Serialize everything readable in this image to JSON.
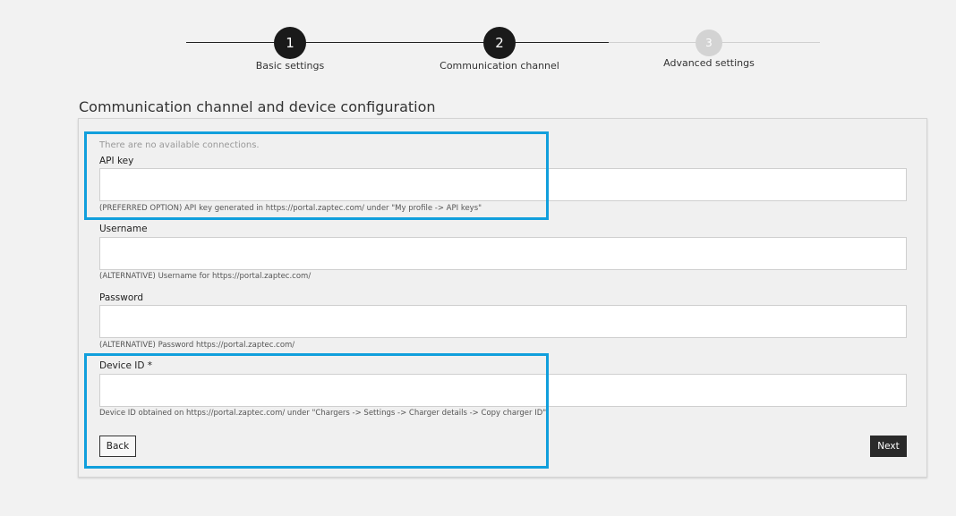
{
  "stepper": {
    "steps": [
      {
        "number": "1",
        "label": "Basic settings",
        "state": "completed"
      },
      {
        "number": "2",
        "label": "Communication channel",
        "state": "active"
      },
      {
        "number": "3",
        "label": "Advanced settings",
        "state": "pending"
      }
    ]
  },
  "section": {
    "title": "Communication channel and device configuration"
  },
  "form": {
    "note": "There are no available connections.",
    "api_key": {
      "label": "API key",
      "value": "",
      "hint": "(PREFERRED OPTION) API key generated in https://portal.zaptec.com/ under \"My profile -> API keys\""
    },
    "username": {
      "label": "Username",
      "value": "",
      "hint": "(ALTERNATIVE) Username for https://portal.zaptec.com/"
    },
    "password": {
      "label": "Password",
      "value": "",
      "hint": "(ALTERNATIVE) Password https://portal.zaptec.com/"
    },
    "device_id": {
      "label": "Device ID *",
      "value": "",
      "hint": "Device ID obtained on https://portal.zaptec.com/ under \"Chargers -> Settings -> Charger details -> Copy charger ID\""
    }
  },
  "actions": {
    "back_label": "Back",
    "next_label": "Next"
  },
  "colors": {
    "highlight": "#119fdc",
    "step_active": "#1a1a1a",
    "step_pending": "#d3d3d3",
    "next_button": "#2a2a2a"
  }
}
